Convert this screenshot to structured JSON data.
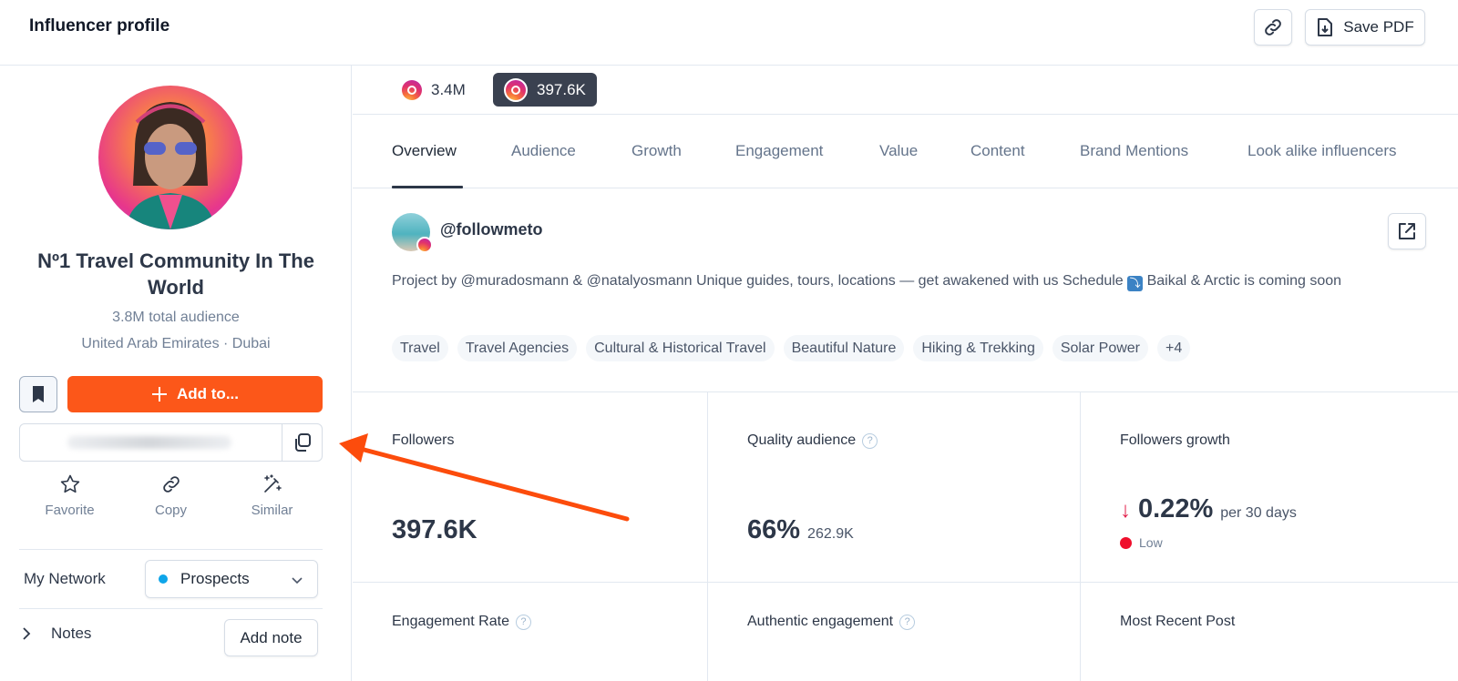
{
  "header": {
    "title": "Influencer profile",
    "save_pdf_label": "Save PDF",
    "link_icon": "link-icon",
    "pdf_icon": "file-download-icon"
  },
  "profile": {
    "name": "Nº1 Travel Community In The World",
    "total_audience": "3.8M total audience",
    "location": "United Arab Emirates · Dubai",
    "add_to_label": "Add to...",
    "email_value_hidden": true,
    "quick_actions": [
      {
        "label": "Favorite",
        "icon": "star-icon"
      },
      {
        "label": "Copy",
        "icon": "link-icon"
      },
      {
        "label": "Similar",
        "icon": "magic-wand-icon"
      }
    ],
    "network": {
      "label": "My Network",
      "selected": "Prospects",
      "dot_color": "#0ea5e9"
    },
    "notes": {
      "label": "Notes",
      "add_label": "Add note"
    }
  },
  "accounts": [
    {
      "platform": "instagram",
      "followers": "3.4M",
      "selected": false
    },
    {
      "platform": "instagram",
      "followers": "397.6K",
      "selected": true
    }
  ],
  "tabs": [
    {
      "label": "Overview",
      "active": true
    },
    {
      "label": "Audience",
      "active": false
    },
    {
      "label": "Growth",
      "active": false
    },
    {
      "label": "Engagement",
      "active": false
    },
    {
      "label": "Value",
      "active": false
    },
    {
      "label": "Content",
      "active": false
    },
    {
      "label": "Brand Mentions",
      "active": false
    },
    {
      "label": "Look alike influencers",
      "active": false
    }
  ],
  "account": {
    "handle": "@followmeto",
    "bio_part1": "Project by @muradosmann & @natalyosmann Unique guides, tours, locations — get awakened with us Schedule ",
    "bio_emoji": "⤵",
    "bio_part2": " Baikal & Arctic is coming soon",
    "tags": [
      "Travel",
      "Travel Agencies",
      "Cultural & Historical Travel",
      "Beautiful Nature",
      "Hiking & Trekking",
      "Solar Power",
      "+4"
    ]
  },
  "stats": {
    "followers": {
      "title": "Followers",
      "value": "397.6K"
    },
    "quality_audience": {
      "title": "Quality audience",
      "value": "66%",
      "sub": "262.9K"
    },
    "followers_growth": {
      "title": "Followers growth",
      "value": "0.22%",
      "direction": "down",
      "sub": "per 30 days",
      "rating": "Low",
      "rating_color": "#ef0f2c"
    },
    "engagement_rate": {
      "title": "Engagement Rate"
    },
    "authentic_engagement": {
      "title": "Authentic engagement"
    },
    "most_recent_post": {
      "title": "Most Recent Post"
    }
  },
  "colors": {
    "accent": "#fc5719",
    "selected_chip": "#3a4150",
    "annotation_arrow": "#fc4c0c"
  }
}
